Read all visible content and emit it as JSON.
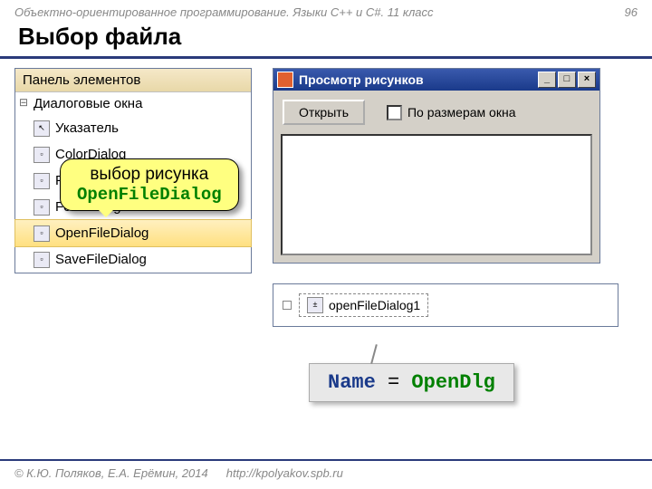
{
  "header": {
    "subject": "Объектно-ориентированное программирование. Языки C++ и C#. 11 класс",
    "page": "96"
  },
  "title": "Выбор файла",
  "toolbox": {
    "panel_title": "Панель элементов",
    "group": "Диалоговые окна",
    "items": [
      "Указатель",
      "ColorDialog",
      "FolderBrowserDialog",
      "FontDialog",
      "OpenFileDialog",
      "SaveFileDialog"
    ],
    "selected_index": 4
  },
  "callout": {
    "line1": "выбор рисунка",
    "line2": "OpenFileDialog"
  },
  "app": {
    "title": "Просмотр рисунков",
    "open_btn": "Открыть",
    "checkbox_label": "По размерам окна"
  },
  "tray": {
    "item": "openFileDialog1"
  },
  "name_assign": {
    "key": "Name",
    "op": " = ",
    "val": "OpenDlg"
  },
  "footer": {
    "copyright": "© К.Ю. Поляков, Е.А. Ерёмин, 2014",
    "url": "http://kpolyakov.spb.ru"
  }
}
